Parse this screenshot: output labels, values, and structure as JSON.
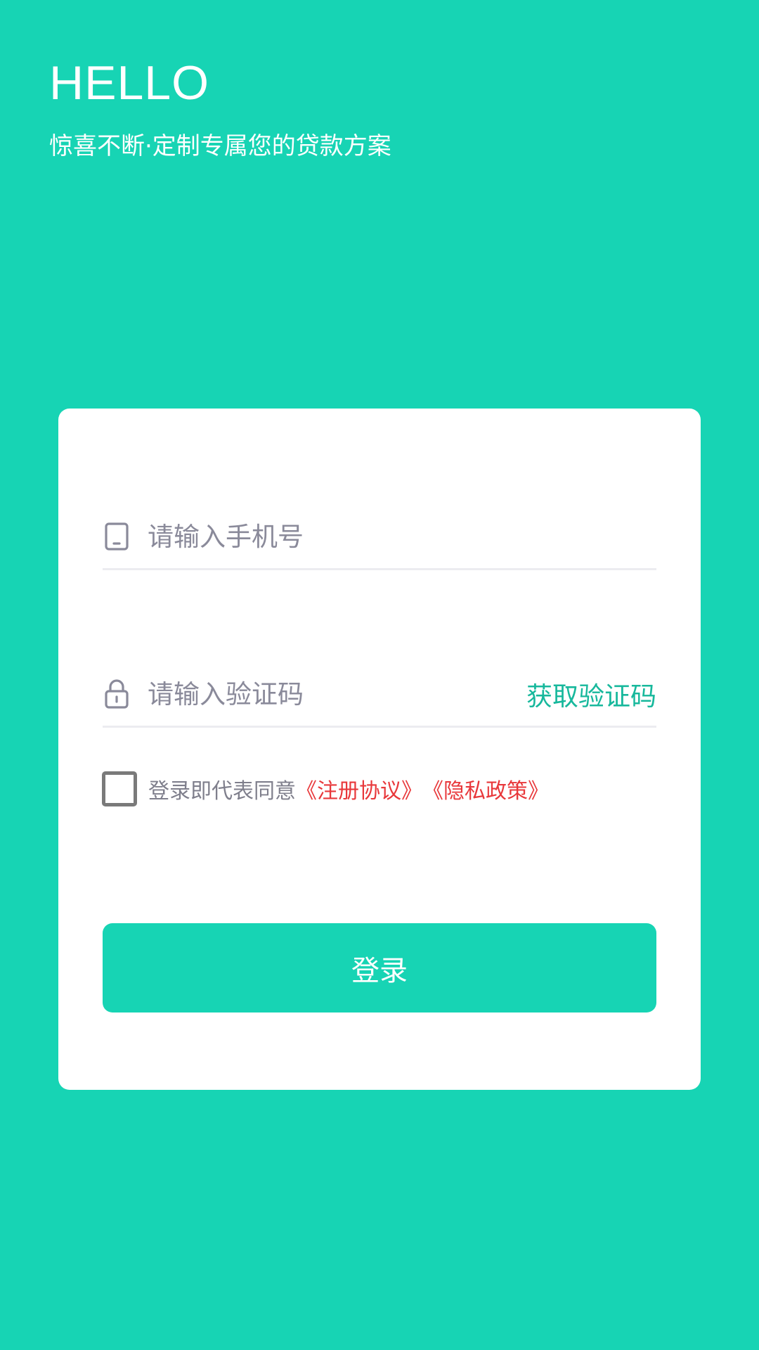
{
  "header": {
    "greeting": "HELLO",
    "tagline": "惊喜不断·定制专属您的贷款方案"
  },
  "login_form": {
    "phone": {
      "placeholder": "请输入手机号",
      "value": "",
      "icon": "phone-icon"
    },
    "code": {
      "placeholder": "请输入验证码",
      "value": "",
      "icon": "lock-icon",
      "get_code_label": "获取验证码"
    },
    "agreement": {
      "checked": false,
      "prefix": "登录即代表同意",
      "register_link": "《注册协议》",
      "privacy_link": "《隐私政策》"
    },
    "submit_label": "登录"
  },
  "colors": {
    "background": "#17d4b4",
    "accent_text": "#17b89c",
    "link": "#e8383b",
    "card": "#ffffff"
  }
}
